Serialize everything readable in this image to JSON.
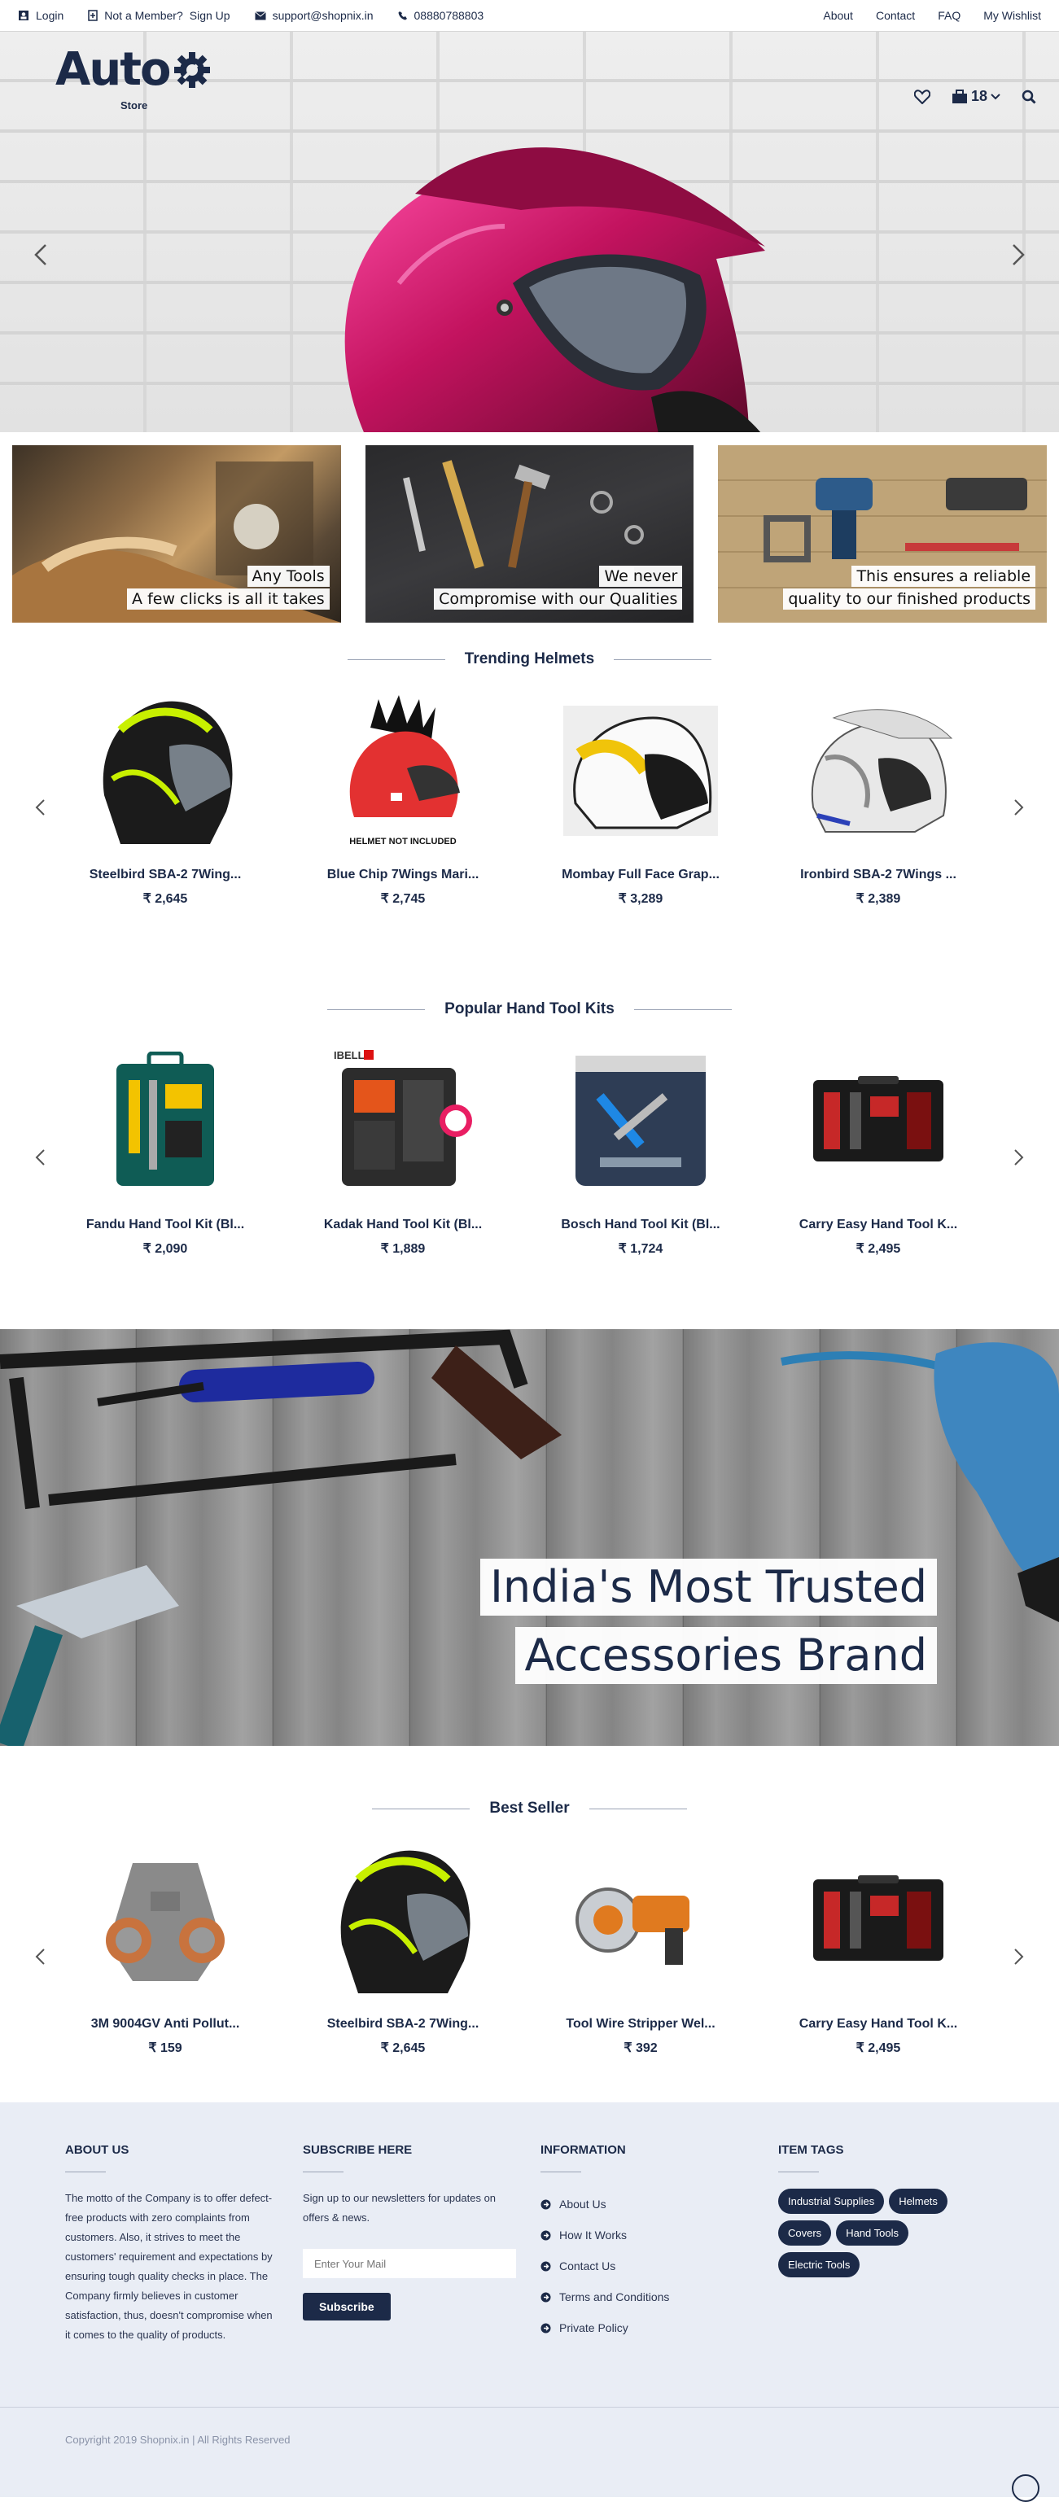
{
  "topbar": {
    "login": "Login",
    "member_prompt": "Not a Member?",
    "signup": "Sign Up",
    "email": "support@shopnix.in",
    "phone": "08880788803",
    "nav": [
      "About",
      "Contact",
      "FAQ",
      "My Wishlist"
    ]
  },
  "brand": {
    "name": "Auto",
    "sub": "Store"
  },
  "header": {
    "cart_count": "18"
  },
  "banners": [
    {
      "line1": "Any Tools",
      "line2": "A few clicks is all it takes"
    },
    {
      "line1": "We never",
      "line2": "Compromise with our Qualities"
    },
    {
      "line1": "This ensures a reliable",
      "line2": "quality to our finished products"
    }
  ],
  "sections": {
    "trending": {
      "title": "Trending Helmets",
      "products": [
        {
          "name": "Steelbird SBA-2 7Wing...",
          "price": "₹ 2,645"
        },
        {
          "name": "Blue Chip 7Wings Mari...",
          "price": "₹ 2,745",
          "badge": "HELMET NOT INCLUDED"
        },
        {
          "name": "Mombay Full Face Grap...",
          "price": "₹ 3,289"
        },
        {
          "name": "Ironbird SBA-2 7Wings ...",
          "price": "₹ 2,389"
        }
      ]
    },
    "toolkits": {
      "title": "Popular Hand Tool Kits",
      "products": [
        {
          "name": "Fandu Hand Tool Kit (Bl...",
          "price": "₹ 2,090"
        },
        {
          "name": "Kadak Hand Tool Kit (Bl...",
          "price": "₹ 1,889"
        },
        {
          "name": "Bosch Hand Tool Kit (Bl...",
          "price": "₹ 1,724"
        },
        {
          "name": "Carry Easy Hand Tool K...",
          "price": "₹ 2,495"
        }
      ]
    },
    "bestseller": {
      "title": "Best Seller",
      "products": [
        {
          "name": "3M 9004GV Anti Pollut...",
          "price": "₹ 159"
        },
        {
          "name": "Steelbird SBA-2 7Wing...",
          "price": "₹ 2,645"
        },
        {
          "name": "Tool Wire Stripper Wel...",
          "price": "₹ 392"
        },
        {
          "name": "Carry Easy Hand Tool K...",
          "price": "₹ 2,495"
        }
      ]
    }
  },
  "big_banner": {
    "line1": "India's Most Trusted",
    "line2": "Accessories Brand"
  },
  "footer": {
    "about": {
      "title": "ABOUT US",
      "text": "The motto of the Company is to offer defect-free products with zero complaints from customers. Also, it strives to meet the customers' requirement and expectations by ensuring tough quality checks in place. The Company firmly believes in customer satisfaction, thus, doesn't compromise when it comes to the quality of products."
    },
    "subscribe": {
      "title": "SUBSCRIBE HERE",
      "text": "Sign up to our newsletters for updates on offers & news.",
      "placeholder": "Enter Your Mail",
      "button": "Subscribe"
    },
    "information": {
      "title": "INFORMATION",
      "links": [
        "About Us",
        "How It Works",
        "Contact Us",
        "Terms and Conditions",
        "Private Policy"
      ]
    },
    "tags": {
      "title": "ITEM TAGS",
      "items": [
        "Industrial Supplies",
        "Helmets",
        "Covers",
        "Hand Tools",
        "Electric Tools"
      ]
    },
    "copyright": "Copyright 2019 Shopnix.in | All Rights Reserved"
  }
}
